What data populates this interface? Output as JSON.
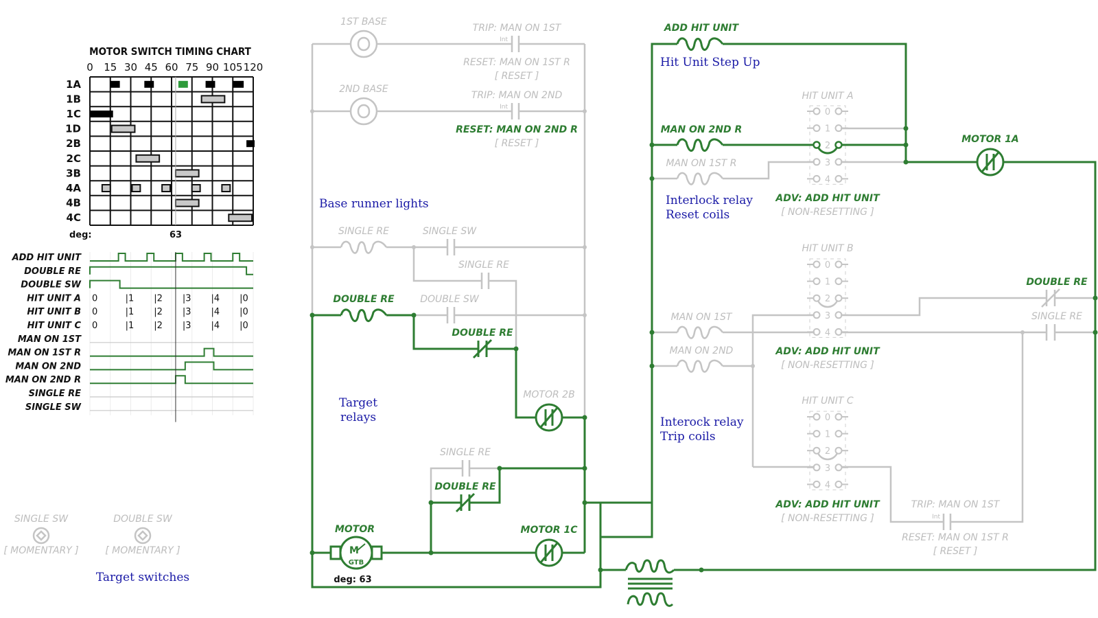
{
  "colors": {
    "active": "#2e7d32",
    "inactive": "#c4c4c4",
    "note": "#1a1aa6",
    "highlight": "#2e9b3a",
    "bar_gray": "#c8c8c8",
    "bar_black": "#000000"
  },
  "timing_chart": {
    "title": "MOTOR SWITCH TIMING CHART",
    "ticks": [
      "0",
      "15",
      "30",
      "45",
      "60",
      "75",
      "90",
      "105",
      "120"
    ],
    "deg_label": "deg:",
    "deg_value": "63",
    "current_deg": 63,
    "rows": [
      {
        "label": "1A",
        "bars": [
          {
            "start": 15,
            "end": 22,
            "style": "black"
          },
          {
            "start": 40,
            "end": 47,
            "style": "black"
          },
          {
            "start": 65,
            "end": 72,
            "style": "green"
          },
          {
            "start": 85,
            "end": 92,
            "style": "black"
          },
          {
            "start": 105,
            "end": 113,
            "style": "black"
          }
        ]
      },
      {
        "label": "1B",
        "bars": [
          {
            "start": 82,
            "end": 99,
            "style": "gray"
          }
        ]
      },
      {
        "label": "1C",
        "bars": [
          {
            "start": 0,
            "end": 17,
            "style": "black"
          }
        ]
      },
      {
        "label": "1D",
        "bars": [
          {
            "start": 16,
            "end": 33,
            "style": "gray"
          }
        ]
      },
      {
        "label": "2B",
        "bars": [
          {
            "start": 115,
            "end": 121,
            "style": "black"
          }
        ]
      },
      {
        "label": "2C",
        "bars": [
          {
            "start": 34,
            "end": 51,
            "style": "gray"
          }
        ]
      },
      {
        "label": "3B",
        "bars": [
          {
            "start": 63,
            "end": 80,
            "style": "gray"
          }
        ]
      },
      {
        "label": "4A",
        "bars": [
          {
            "start": 9,
            "end": 15,
            "style": "gray"
          },
          {
            "start": 31,
            "end": 37,
            "style": "gray"
          },
          {
            "start": 53,
            "end": 59,
            "style": "gray"
          },
          {
            "start": 75,
            "end": 81,
            "style": "gray"
          },
          {
            "start": 97,
            "end": 103,
            "style": "gray"
          }
        ]
      },
      {
        "label": "4B",
        "bars": [
          {
            "start": 63,
            "end": 80,
            "style": "gray"
          }
        ]
      },
      {
        "label": "4C",
        "bars": [
          {
            "start": 102,
            "end": 119,
            "style": "gray"
          }
        ]
      }
    ]
  },
  "timeline": {
    "signals": [
      {
        "label": "ADD HIT UNIT",
        "type": "wave",
        "pulses": [
          [
            21,
            26
          ],
          [
            42,
            47
          ],
          [
            63,
            68
          ],
          [
            84,
            89
          ],
          [
            105,
            110
          ]
        ]
      },
      {
        "label": "DOUBLE RE",
        "type": "wave",
        "pulses": [
          [
            0,
            115
          ]
        ]
      },
      {
        "label": "DOUBLE SW",
        "type": "wave",
        "pulses": [
          [
            0,
            22
          ]
        ]
      },
      {
        "label": "HIT UNIT A",
        "type": "steps",
        "values": [
          {
            "at": 0,
            "text": "0"
          },
          {
            "at": 26,
            "text": "|1"
          },
          {
            "at": 47,
            "text": "|2"
          },
          {
            "at": 68,
            "text": "|3"
          },
          {
            "at": 89,
            "text": "|4"
          },
          {
            "at": 110,
            "text": "|0"
          }
        ]
      },
      {
        "label": "HIT UNIT B",
        "type": "steps",
        "values": [
          {
            "at": 0,
            "text": "0"
          },
          {
            "at": 26,
            "text": "|1"
          },
          {
            "at": 47,
            "text": "|2"
          },
          {
            "at": 68,
            "text": "|3"
          },
          {
            "at": 89,
            "text": "|4"
          },
          {
            "at": 110,
            "text": "|0"
          }
        ]
      },
      {
        "label": "HIT UNIT C",
        "type": "steps",
        "values": [
          {
            "at": 0,
            "text": "0"
          },
          {
            "at": 26,
            "text": "|1"
          },
          {
            "at": 47,
            "text": "|2"
          },
          {
            "at": 68,
            "text": "|3"
          },
          {
            "at": 89,
            "text": "|4"
          },
          {
            "at": 110,
            "text": "|0"
          }
        ]
      },
      {
        "label": "MAN ON 1ST",
        "type": "wave",
        "pulses": []
      },
      {
        "label": "MAN ON 1ST R",
        "type": "wave",
        "pulses": [
          [
            84,
            91
          ]
        ]
      },
      {
        "label": "MAN ON 2ND",
        "type": "wave",
        "pulses": [
          [
            70,
            91
          ]
        ]
      },
      {
        "label": "MAN ON 2ND R",
        "type": "wave",
        "pulses": [
          [
            63,
            70
          ]
        ]
      },
      {
        "label": "SINGLE RE",
        "type": "wave",
        "pulses": []
      },
      {
        "label": "SINGLE SW",
        "type": "wave",
        "pulses": []
      }
    ]
  },
  "switches": [
    {
      "label": "SINGLE SW",
      "mode": "[ MOMENTARY ]"
    },
    {
      "label": "DOUBLE SW",
      "mode": "[ MOMENTARY ]"
    }
  ],
  "notes": {
    "target_switches": "Target switches",
    "base_runner_lights": "Base runner lights",
    "target_relays_1": "Target",
    "target_relays_2": "relays",
    "hit_unit_step_up": "Hit Unit Step Up",
    "interlock_reset_1": "Interlock relay",
    "interlock_reset_2": "Reset coils",
    "interlock_trip_1": "Interock relay",
    "interlock_trip_2": "Trip coils"
  },
  "components": {
    "lamp_1st": "1ST BASE",
    "lamp_2nd": "2ND BASE",
    "trip_1st": "TRIP: MAN ON 1ST",
    "reset_1st": "RESET: MAN ON 1ST R",
    "reset_tag": "[ RESET ]",
    "trip_2nd": "TRIP: MAN ON 2ND",
    "reset_2nd": "RESET: MAN ON 2ND R",
    "int": "Int",
    "single_re_coil": "SINGLE RE",
    "single_sw_contact": "SINGLE SW",
    "single_re_contact": "SINGLE RE",
    "double_re_coil": "DOUBLE RE",
    "double_sw_contact": "DOUBLE SW",
    "double_re_nc": "DOUBLE RE",
    "motor_2b": "MOTOR 2B",
    "single_re_contact2": "SINGLE RE",
    "double_re_nc2": "DOUBLE RE",
    "motor": "MOTOR",
    "motor_m": "M",
    "motor_gtb": "GTB",
    "motor_deg": "deg: 63",
    "motor_1c": "MOTOR 1C",
    "add_hit_unit_coil": "ADD HIT UNIT",
    "man_on_2nd_r_coil": "MAN ON 2ND R",
    "man_on_1st_r_coil": "MAN ON 1ST R",
    "hit_unit_a": "HIT UNIT A",
    "hit_unit_b": "HIT UNIT B",
    "hit_unit_c": "HIT UNIT C",
    "adv": "ADV: ADD HIT UNIT",
    "non_resetting": "[ NON-RESETTING ]",
    "motor_1a": "MOTOR 1A",
    "man_on_1st_coil": "MAN ON 1ST",
    "man_on_2nd_coil": "MAN ON 2ND",
    "double_re_nc3": "DOUBLE RE",
    "single_re_contact3": "SINGLE RE",
    "trip_1st_b": "TRIP: MAN ON 1ST",
    "reset_1st_b": "RESET: MAN ON 1ST R",
    "reset_tag_b": "[ RESET ]",
    "stepper_positions": [
      "0",
      "1",
      "2",
      "3",
      "4"
    ]
  }
}
